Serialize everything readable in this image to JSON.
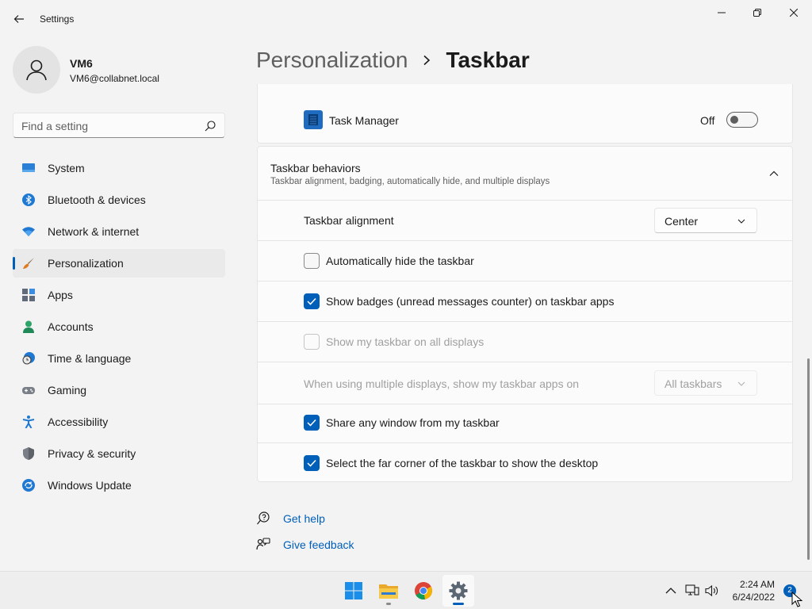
{
  "window": {
    "title": "Settings"
  },
  "profile": {
    "name": "VM6",
    "email": "VM6@collabnet.local"
  },
  "search": {
    "placeholder": "Find a setting"
  },
  "sidebar": {
    "items": [
      {
        "label": "System",
        "icon": "system-icon",
        "selected": false
      },
      {
        "label": "Bluetooth & devices",
        "icon": "bluetooth-icon",
        "selected": false
      },
      {
        "label": "Network & internet",
        "icon": "wifi-icon",
        "selected": false
      },
      {
        "label": "Personalization",
        "icon": "brush-icon",
        "selected": true
      },
      {
        "label": "Apps",
        "icon": "apps-icon",
        "selected": false
      },
      {
        "label": "Accounts",
        "icon": "person-icon",
        "selected": false
      },
      {
        "label": "Time & language",
        "icon": "clock-globe-icon",
        "selected": false
      },
      {
        "label": "Gaming",
        "icon": "gamepad-icon",
        "selected": false
      },
      {
        "label": "Accessibility",
        "icon": "accessibility-icon",
        "selected": false
      },
      {
        "label": "Privacy & security",
        "icon": "shield-icon",
        "selected": false
      },
      {
        "label": "Windows Update",
        "icon": "update-icon",
        "selected": false
      }
    ]
  },
  "header": {
    "parent": "Personalization",
    "current": "Taskbar"
  },
  "task_manager": {
    "label": "Task Manager",
    "toggle_state": "Off"
  },
  "behaviors": {
    "title": "Taskbar behaviors",
    "subtitle": "Taskbar alignment, badging, automatically hide, and multiple displays",
    "alignment_label": "Taskbar alignment",
    "alignment_value": "Center",
    "auto_hide": {
      "label": "Automatically hide the taskbar",
      "checked": false
    },
    "show_badges": {
      "label": "Show badges (unread messages counter) on taskbar apps",
      "checked": true
    },
    "all_displays": {
      "label": "Show my taskbar on all displays",
      "checked": false,
      "disabled": true
    },
    "multi_display_label": "When using multiple displays, show my taskbar apps on",
    "multi_display_value": "All taskbars",
    "share_window": {
      "label": "Share any window from my taskbar",
      "checked": true
    },
    "far_corner": {
      "label": "Select the far corner of the taskbar to show the desktop",
      "checked": true
    }
  },
  "links": {
    "help": "Get help",
    "feedback": "Give feedback"
  },
  "taskbar": {
    "apps": [
      "start-icon",
      "file-explorer-icon",
      "chrome-icon",
      "settings-icon"
    ],
    "time": "2:24 AM",
    "date": "6/24/2022",
    "notification_count": "2"
  },
  "colors": {
    "accent": "#005fb8",
    "background": "#f3f3f3",
    "card": "#fbfbfb"
  }
}
